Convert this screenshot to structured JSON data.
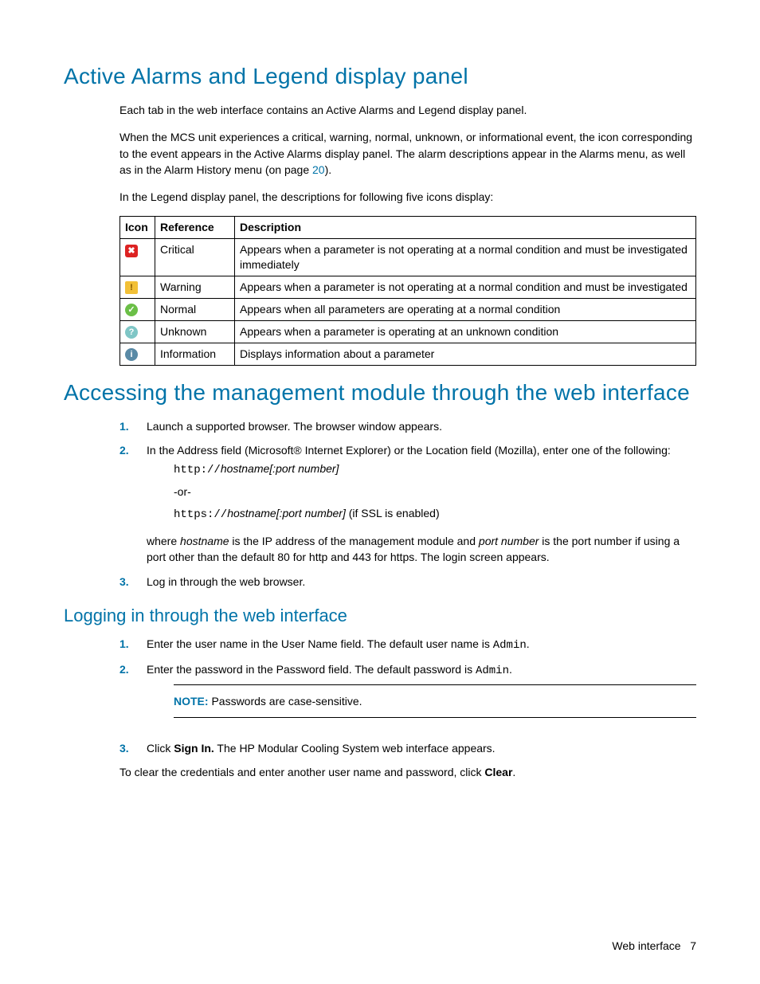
{
  "h1a": "Active Alarms and Legend display panel",
  "p1": "Each tab in the web interface contains an Active Alarms and Legend display panel.",
  "p2_pre": "When the MCS unit experiences a critical, warning, normal, unknown, or informational event, the icon corresponding to the event appears in the Active Alarms display panel. The alarm descriptions appear in the Alarms menu, as well as in the Alarm History menu (on page ",
  "p2_link": "20",
  "p2_post": ").",
  "p3": "In the Legend display panel, the descriptions for following five icons display:",
  "table": {
    "headers": {
      "icon": "Icon",
      "ref": "Reference",
      "desc": "Description"
    },
    "rows": [
      {
        "glyph": "✖",
        "cls": "ico-critical",
        "ref": "Critical",
        "desc": "Appears when a parameter is not operating at a normal condition and must be investigated immediately"
      },
      {
        "glyph": "!",
        "cls": "ico-warning",
        "ref": "Warning",
        "desc": "Appears when a parameter is not operating at a normal condition and must be investigated"
      },
      {
        "glyph": "✓",
        "cls": "ico-normal",
        "ref": "Normal",
        "desc": "Appears when all parameters are operating at a normal condition"
      },
      {
        "glyph": "?",
        "cls": "ico-unknown",
        "ref": "Unknown",
        "desc": "Appears when a parameter is operating at an unknown condition"
      },
      {
        "glyph": "i",
        "cls": "ico-info",
        "ref": "Information",
        "desc": "Displays information about a parameter"
      }
    ]
  },
  "h1b": "Accessing the management module through the web interface",
  "access_steps": {
    "s1": "Launch a supported browser. The browser window appears.",
    "s2": "In the Address field (Microsoft® Internet Explorer) or the Location field (Mozilla), enter one of the following:",
    "url1_pre": "http://",
    "url1_it": "hostname[:port number]",
    "or": "-or-",
    "url2_pre": "https://",
    "url2_it": "hostname[:port number]",
    "url2_post": " (if SSL is enabled)",
    "where_a": "where ",
    "where_h": "hostname",
    "where_b": " is the IP address of the management module and ",
    "where_p": "port number",
    "where_c": " is the port number if using a port other than the default 80 for http and 443 for https. The login screen appears.",
    "s3": "Log in through the web browser."
  },
  "h2a": "Logging in through the web interface",
  "login_steps": {
    "s1_a": "Enter the user name in the User Name field. The default user name is ",
    "s1_code": "Admin",
    "s1_b": ".",
    "s2_a": "Enter the password in the Password field. The default password is ",
    "s2_code": "Admin",
    "s2_b": ".",
    "note_label": "NOTE:",
    "note_text": "  Passwords are case-sensitive.",
    "s3_a": "Click ",
    "s3_bold": "Sign In.",
    "s3_b": " The HP Modular Cooling System web interface appears."
  },
  "clear_a": "To clear the credentials and enter another user name and password, click ",
  "clear_bold": "Clear",
  "clear_b": ".",
  "footer_label": "Web interface",
  "footer_page": "7"
}
